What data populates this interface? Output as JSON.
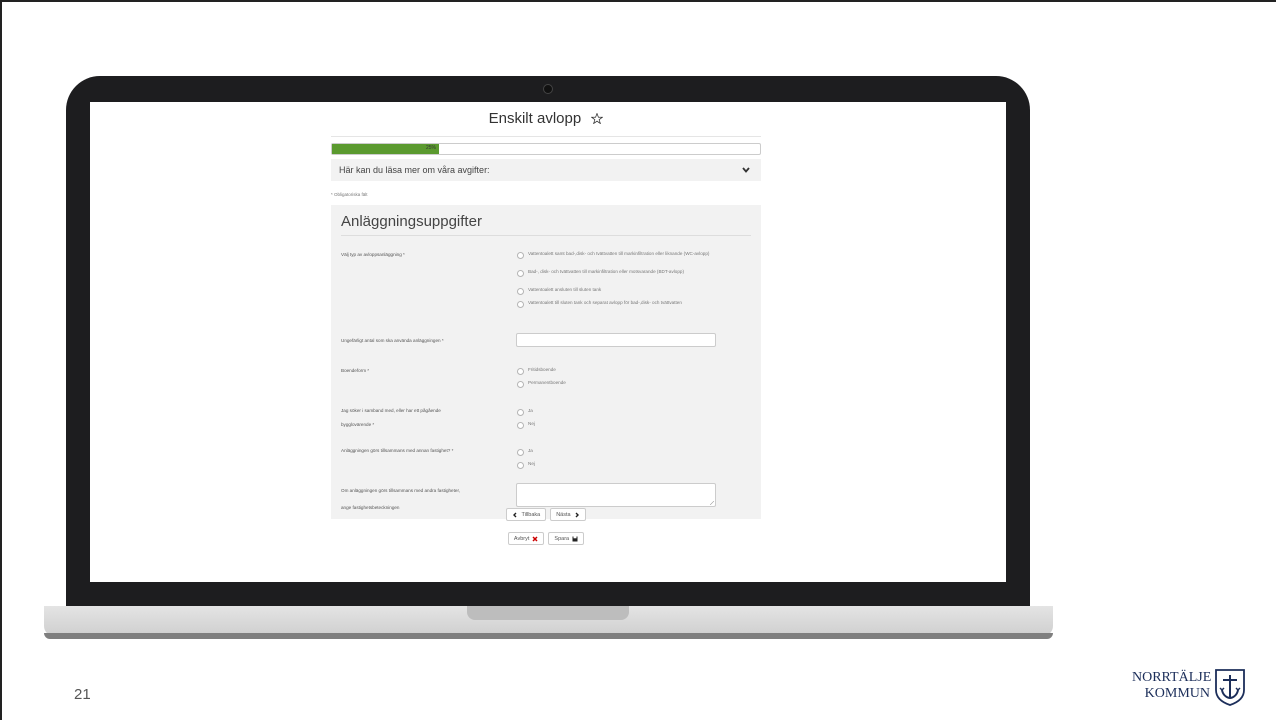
{
  "slide": {
    "page_number": "21"
  },
  "logo": {
    "line1": "NORRTÄLJE",
    "line2": "KOMMUN"
  },
  "form": {
    "title": "Enskilt avlopp",
    "favorite_icon": "star-outline-icon",
    "progress": {
      "percent": 25,
      "label": "25%"
    },
    "accordion_label": "Här kan du läsa mer om våra avgifter:",
    "required_note": "* Obligatoriska fält",
    "section_title": "Anläggningsuppgifter",
    "questions": {
      "type": {
        "label": "Välj typ av avloppsanläggning *",
        "options": [
          "Vattentoalett samt bad-,disk- och tvättvatten till markinfiltration eller liknande (WC-avlopp)",
          "Bad-, disk- och tvättvatten till markinfiltration eller motsvarande (BDT-avlopp)",
          "Vattentoalett ansluten till sluten tank",
          "Vattentoalett till sluten tank och separat avlopp för bad-,disk- och tvättvatten"
        ]
      },
      "count": {
        "label": "Ungefärligt antal som ska använda anläggningen *",
        "value": ""
      },
      "housing": {
        "label": "Boendeform *",
        "options": [
          "Fritidsboende",
          "Permanentboende"
        ]
      },
      "building_permit": {
        "label_line1": "Jag söker i samband med, eller har ett pågående",
        "label_line2": "bygglovärende *",
        "options": [
          "Ja",
          "Nej"
        ]
      },
      "shared": {
        "label": "Anläggningen görs tillsammans med annan fastighet? *",
        "options": [
          "Ja",
          "Nej"
        ]
      },
      "property_ids": {
        "label_line1": "Om anläggningen görs tillsammans med andra fastigheter,",
        "label_line2": "ange fastighetsbeteckningen",
        "value": ""
      }
    },
    "buttons": {
      "back": "Tillbaka",
      "next": "Nästa",
      "cancel": "Avbryt",
      "save": "Spara"
    }
  },
  "colors": {
    "progress": "#5b9a2f",
    "cancel_icon": "#cc0000",
    "logo": "#1c2e5a"
  }
}
